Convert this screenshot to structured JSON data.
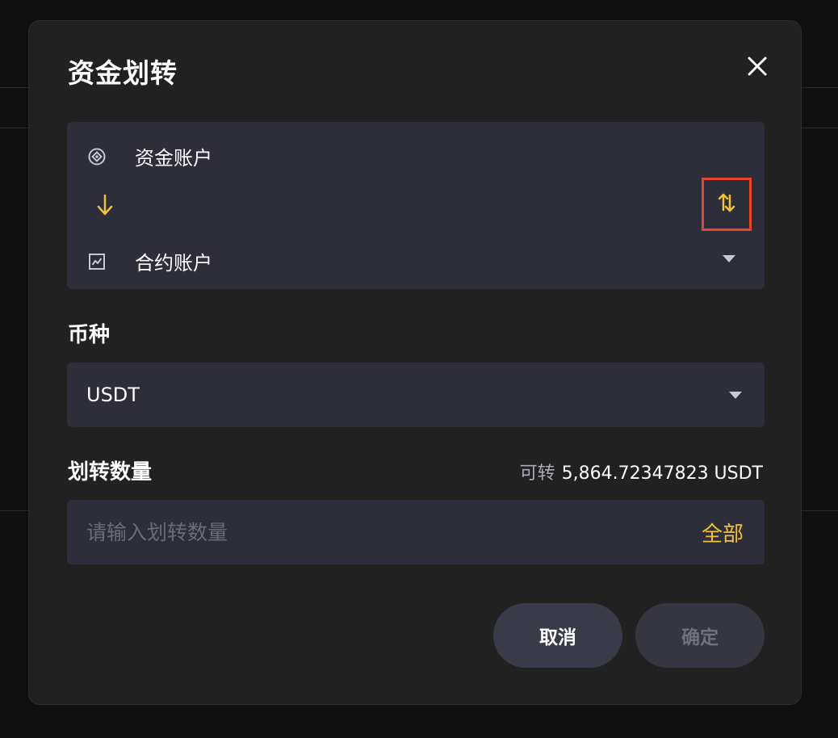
{
  "dialog": {
    "title": "资金划转",
    "close_icon": "close-icon"
  },
  "accounts": {
    "from": {
      "label": "资金账户",
      "icon": "funding-account-icon"
    },
    "to": {
      "label": "合约账户",
      "icon": "futures-account-icon"
    },
    "direction_icon": "arrow-down-icon",
    "swap_icon": "swap-vertical-icon"
  },
  "coin": {
    "label": "币种",
    "selected": "USDT"
  },
  "amount": {
    "label": "划转数量",
    "available_prefix": "可转",
    "available_value": "5,864.72347823 USDT",
    "placeholder": "请输入划转数量",
    "value": "",
    "all_label": "全部"
  },
  "buttons": {
    "cancel": "取消",
    "confirm": "确定"
  },
  "colors": {
    "accent": "#f0c23a",
    "highlight_border": "#e8452c",
    "panel": "#2e2e3b",
    "modal": "#212122"
  }
}
